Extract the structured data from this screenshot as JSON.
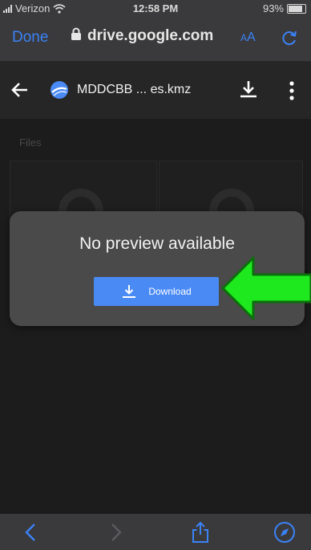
{
  "status_bar": {
    "carrier": "Verizon",
    "time": "12:58 PM",
    "battery": "93%",
    "battery_level": 0.93
  },
  "safari": {
    "done_label": "Done",
    "url": "drive.google.com",
    "aa_label_small": "A",
    "aa_label_large": "A"
  },
  "drive_header": {
    "file_name": "MDDCBB ... es.kmz"
  },
  "background": {
    "files_label": "Files"
  },
  "modal": {
    "title": "No preview available",
    "download_label": "Download"
  },
  "colors": {
    "accent_blue": "#4a8af4",
    "safari_blue": "#3b82f6",
    "arrow_green": "#1ee81e"
  },
  "icons": {
    "header": [
      "back-arrow-icon",
      "google-earth-icon",
      "download-icon",
      "more-vert-icon"
    ],
    "toolbar": [
      "chevron-left-icon",
      "chevron-right-icon",
      "share-icon",
      "compass-icon"
    ]
  }
}
